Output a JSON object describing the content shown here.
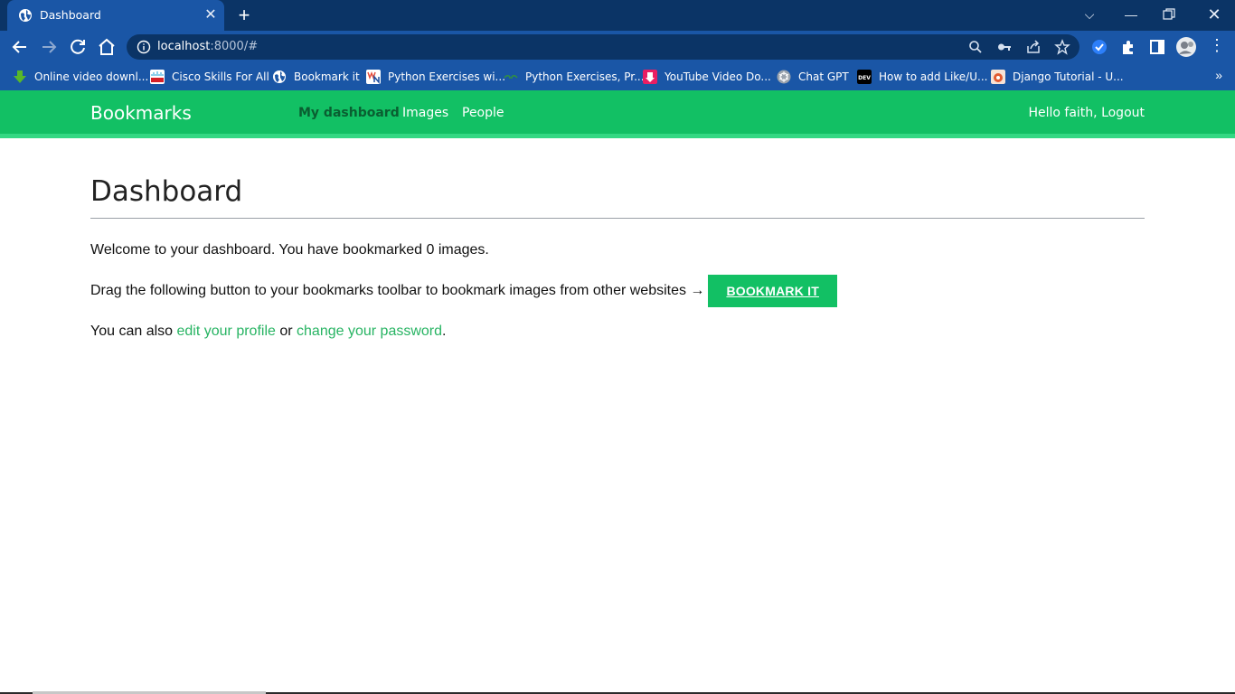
{
  "browser": {
    "tab_title": "Dashboard",
    "url_host": "localhost",
    "url_rest": ":8000/#",
    "bookmarks": [
      {
        "label": "Online video downl...",
        "color": "#58b82a"
      },
      {
        "label": "Cisco Skills For All",
        "color": "#d61f26"
      },
      {
        "label": "Bookmark it",
        "color": "#e8eef8"
      },
      {
        "label": "Python Exercises wi...",
        "color": "#f4f4f4"
      },
      {
        "label": "Python Exercises, Pr...",
        "color": "#2f8d46"
      },
      {
        "label": "YouTube Video Do...",
        "color": "#e91e63"
      },
      {
        "label": "Chat GPT",
        "color": "#9aa3ad"
      },
      {
        "label": "How to add Like/U...",
        "color": "#000000"
      },
      {
        "label": "Django Tutorial - U...",
        "color": "#e25a30"
      }
    ]
  },
  "site": {
    "logo": "Bookmarks",
    "menu": [
      {
        "label": "My dashboard",
        "selected": true
      },
      {
        "label": "Images",
        "selected": false
      },
      {
        "label": "People",
        "selected": false
      }
    ],
    "greeting": "Hello faith,",
    "logout": "Logout",
    "accent_color": "#12c064"
  },
  "page": {
    "title": "Dashboard",
    "welcome": "Welcome to your dashboard. You have bookmarked 0 images.",
    "drag_text": "Drag the following button to your bookmarks toolbar to bookmark images from other websites →",
    "bookmark_button": "BOOKMARK IT",
    "also_prefix": "You can also",
    "edit_profile": "edit your profile",
    "or": "or",
    "change_password": "change your password",
    "period": "."
  }
}
